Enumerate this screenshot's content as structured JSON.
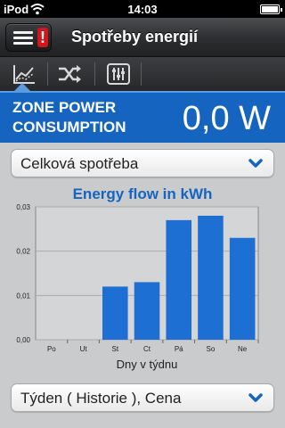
{
  "status_bar": {
    "carrier": "iPod",
    "time": "14:03"
  },
  "nav": {
    "title": "Spotřeby energií",
    "menu_alert": "!"
  },
  "tabs": [
    {
      "icon": "chart-trend-icon",
      "active": true
    },
    {
      "icon": "shuffle-arrows-icon",
      "active": false
    },
    {
      "icon": "sliders-icon",
      "active": false
    }
  ],
  "zone": {
    "label": "ZONE POWER CONSUMPTION",
    "value": "0,0 W"
  },
  "selector_top": {
    "value": "Celková spotřeba"
  },
  "selector_bottom": {
    "value": "Týden ( Historie ), Cena"
  },
  "colors": {
    "accent": "#1565c0",
    "bar": "#1e6fd3",
    "alert": "#d3161b"
  },
  "chart_data": {
    "type": "bar",
    "title": "Energy flow in kWh",
    "xlabel": "Dny v týdnu",
    "ylabel": "",
    "categories": [
      "Po",
      "Ut",
      "St",
      "Ct",
      "Pá",
      "So",
      "Ne"
    ],
    "values": [
      0,
      0,
      0.012,
      0.013,
      0.027,
      0.028,
      0.023
    ],
    "ylim": [
      0,
      0.03
    ],
    "yticks": [
      0,
      0.01,
      0.02,
      0.03
    ],
    "ytick_labels": [
      "0,00",
      "0,01",
      "0,02",
      "0,03"
    ],
    "grid": true
  }
}
